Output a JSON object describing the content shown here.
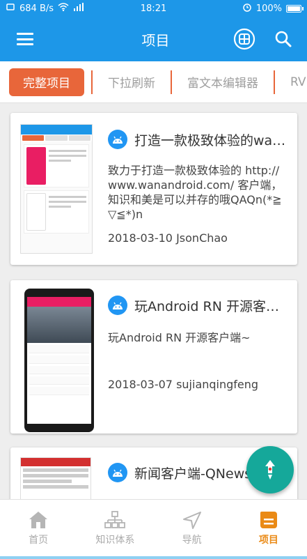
{
  "status_bar": {
    "network_speed": "684 B/s",
    "time": "18:21",
    "battery": "100%",
    "battery_level": 1.0
  },
  "app_bar": {
    "title": "项目",
    "menu_icon": "hamburger-menu-icon",
    "action_icons": [
      "project-grid-icon",
      "search-icon"
    ]
  },
  "tabs": [
    {
      "label": "完整项目",
      "active": true
    },
    {
      "label": "下拉刷新",
      "active": false
    },
    {
      "label": "富文本编辑器",
      "active": false
    },
    {
      "label": "RV",
      "active": false
    }
  ],
  "projects": [
    {
      "title": "打造一款极致体验的wa…",
      "desc": "致力于打造一款极致体验的 http://www.wanandroid.com/ 客户端，知识和美是可以并存的哦QAQn(*≧▽≦*)n",
      "date": "2018-03-10",
      "author": "JsonChao"
    },
    {
      "title": "玩Android RN 开源客户…",
      "desc": "玩Android RN 开源客户端~",
      "date": "2018-03-07",
      "author": "sujianqingfeng"
    },
    {
      "title": "新闻客户端-QNews",
      "desc": "",
      "date": "",
      "author": ""
    }
  ],
  "fab": {
    "icon": "rocket-up-icon"
  },
  "bottom_nav": [
    {
      "label": "首页",
      "icon": "home-icon",
      "active": false
    },
    {
      "label": "知识体系",
      "icon": "tree-structure-icon",
      "active": false
    },
    {
      "label": "导航",
      "icon": "navigation-arrow-icon",
      "active": false
    },
    {
      "label": "项目",
      "icon": "project-doc-icon",
      "active": true
    }
  ],
  "colors": {
    "primary": "#1d97e8",
    "tab_accent": "#e8663a",
    "fab": "#15a89a",
    "nav_active": "#ea8a16",
    "android_badge": "#2196f3"
  }
}
